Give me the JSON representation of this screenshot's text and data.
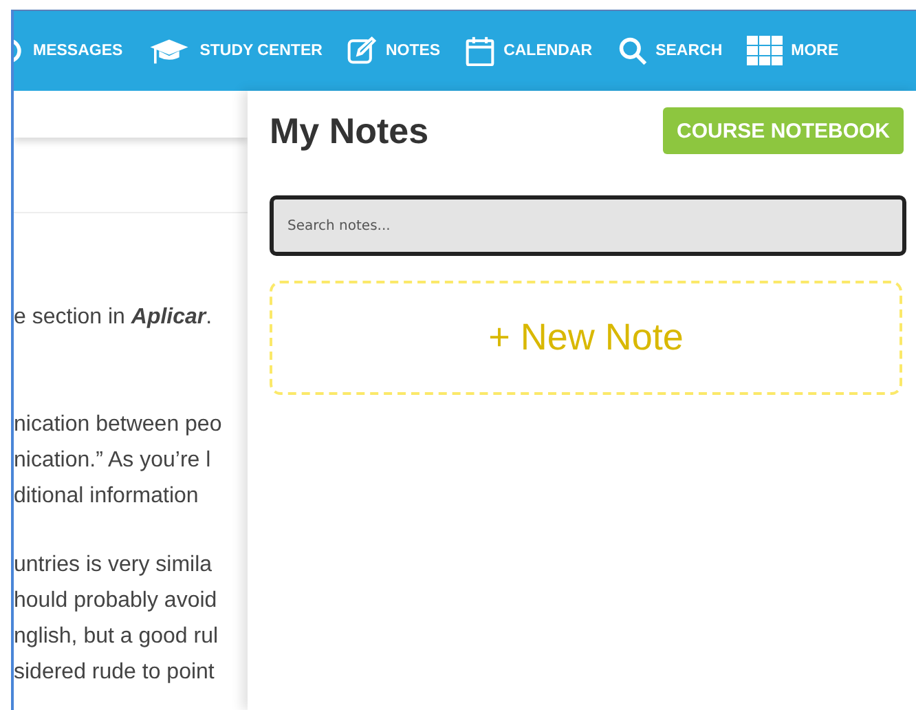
{
  "nav": [
    {
      "kind": "messages",
      "label": "MESSAGES"
    },
    {
      "kind": "study",
      "label": "STUDY CENTER"
    },
    {
      "kind": "notes",
      "label": "NOTES"
    },
    {
      "kind": "calendar",
      "label": "CALENDAR"
    },
    {
      "kind": "search",
      "label": "SEARCH"
    },
    {
      "kind": "more",
      "label": "MORE"
    }
  ],
  "lesson": {
    "paragraphs": [
      [
        "e section in **Aplicar**."
      ],
      [
        "nication between peo",
        "nication.” As you’re l",
        "ditional information"
      ],
      [
        "untries is very simila",
        "hould probably avoid",
        "nglish, but a good rul",
        "sidered rude to point"
      ]
    ]
  },
  "notes": {
    "title": "My Notes",
    "notebook_button": "COURSE NOTEBOOK",
    "search": {
      "placeholder": "Search notes..."
    },
    "new_note": "+ New Note"
  }
}
